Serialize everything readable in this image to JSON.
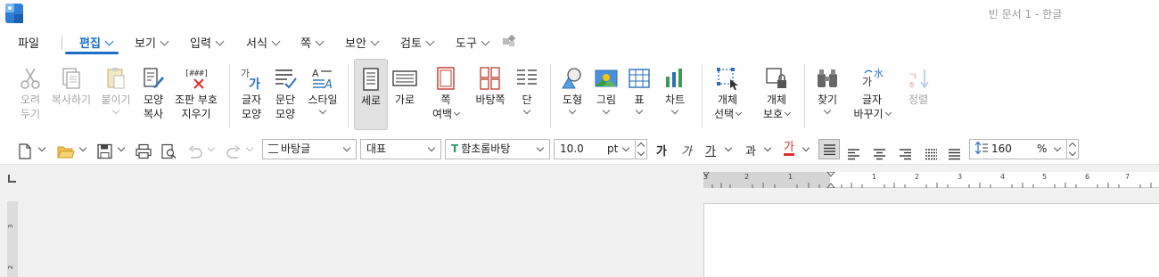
{
  "window": {
    "title": "빈 문서 1 - 한글"
  },
  "menu": {
    "file": "파일",
    "items": [
      {
        "label": "편집",
        "active": true
      },
      {
        "label": "보기"
      },
      {
        "label": "입력"
      },
      {
        "label": "서식"
      },
      {
        "label": "쪽"
      },
      {
        "label": "보안"
      },
      {
        "label": "검토"
      },
      {
        "label": "도구"
      }
    ]
  },
  "ribbon": {
    "cut": [
      "오려",
      "두기"
    ],
    "copy": "복사하기",
    "paste": "붙이기",
    "format_copy": [
      "모양",
      "복사"
    ],
    "clear_format": [
      "조판 부호",
      "지우기"
    ],
    "char_shape": [
      "글자",
      "모양"
    ],
    "para_shape": [
      "문단",
      "모양"
    ],
    "style": "스타일",
    "portrait": "세로",
    "landscape": "가로",
    "page_margin": [
      "쪽",
      "여백"
    ],
    "background": "바탕쪽",
    "columns": "단",
    "shape": "도형",
    "picture": "그림",
    "table": "표",
    "chart": "차트",
    "select_object": [
      "개체",
      "선택"
    ],
    "protect_object": [
      "개체",
      "보호"
    ],
    "find": "찾기",
    "replace": [
      "글자",
      "바꾸기"
    ],
    "sort": "정렬",
    "clear_icon_text": "[###]",
    "char_icon_text": "가",
    "replace_icon_text": "水"
  },
  "toolbar": {
    "style_name": "바탕글",
    "lang": "대표",
    "font": "함초롬바탕",
    "font_icon": "T",
    "font_size": "10.0",
    "unit": "pt",
    "bold": "가",
    "italic": "가",
    "underline": "가",
    "strike": "과",
    "color": "가",
    "line_spacing": "160",
    "percent": "%"
  },
  "ruler": {
    "numbers": [
      "3",
      "2",
      "1",
      "1",
      "2",
      "3",
      "4",
      "5",
      "6",
      "7"
    ],
    "vnumbers": [
      "3",
      "2"
    ]
  },
  "colors": {
    "accent": "#1a6fc9",
    "red": "#e03030",
    "disabled": "#a6a6a6"
  }
}
